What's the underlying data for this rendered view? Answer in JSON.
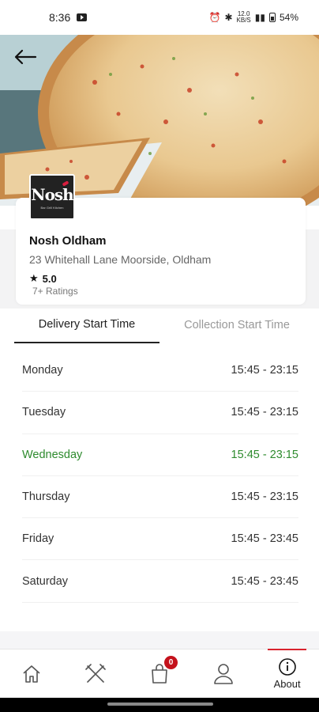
{
  "status_bar": {
    "time": "8:36",
    "battery": "54%",
    "net_speed_value": "12.0",
    "net_speed_unit": "KB/S"
  },
  "restaurant": {
    "logo_text": "Nosh",
    "logo_subtext": "Bar Grill Kitchen",
    "name": "Nosh Oldham",
    "address": "23 Whitehall Lane Moorside, Oldham",
    "rating": "5.0",
    "ratings_count": "7+ Ratings"
  },
  "tabs": {
    "delivery": "Delivery Start Time",
    "collection": "Collection Start Time"
  },
  "hours": [
    {
      "day": "Monday",
      "time": "15:45 - 23:15"
    },
    {
      "day": "Tuesday",
      "time": "15:45 - 23:15"
    },
    {
      "day": "Wednesday",
      "time": "15:45 - 23:15"
    },
    {
      "day": "Thursday",
      "time": "15:45 - 23:15"
    },
    {
      "day": "Friday",
      "time": "15:45 - 23:45"
    },
    {
      "day": "Saturday",
      "time": "15:45 - 23:45"
    }
  ],
  "nav": {
    "cart_badge": "0",
    "about_label": "About"
  },
  "colors": {
    "accent_red": "#d9232e",
    "today_green": "#2e8b2e",
    "badge_red": "#c4121c"
  }
}
